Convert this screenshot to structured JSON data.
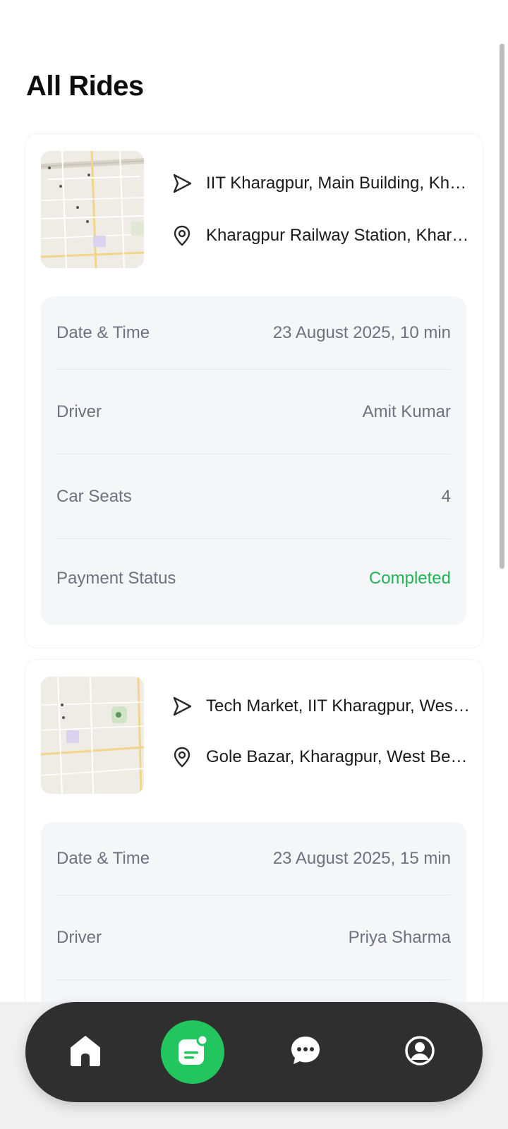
{
  "page": {
    "title": "All Rides"
  },
  "rides": [
    {
      "from": "IIT Kharagpur, Main Building, Kharagpur, West Bengal",
      "to": "Kharagpur Railway Station, Kharagpur, West Bengal",
      "labels": {
        "date": "Date & Time",
        "driver": "Driver",
        "seats": "Car Seats",
        "payment": "Payment Status"
      },
      "date": "23 August 2025, 10 min",
      "driver": "Amit Kumar",
      "seats": "4",
      "payment": "Completed"
    },
    {
      "from": "Tech Market, IIT Kharagpur, West Bengal",
      "to": "Gole Bazar, Kharagpur, West Bengal",
      "labels": {
        "date": "Date & Time",
        "driver": "Driver"
      },
      "date": "23 August 2025, 15 min",
      "driver": "Priya Sharma"
    }
  ],
  "nav": {
    "items": [
      "home-icon",
      "rides-icon",
      "chat-icon",
      "profile-icon"
    ],
    "active": "rides-icon"
  },
  "colors": {
    "accent": "#22c55e",
    "nav_bg": "#2f2f2f",
    "status_ok": "#1fb458"
  }
}
